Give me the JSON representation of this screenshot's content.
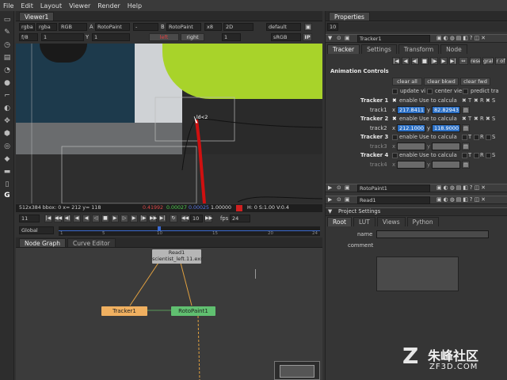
{
  "menu": [
    "File",
    "Edit",
    "Layout",
    "Viewer",
    "Render",
    "Help"
  ],
  "viewer": {
    "tab": "Viewer1",
    "channels": "rgba",
    "layer": "rgba",
    "display": "RGB",
    "a_node": "A",
    "a_input": "RotoPaint",
    "wipe": "-",
    "b_node": "B",
    "b_input": "RotoPaint",
    "zoom": "x8",
    "view_mode": "2D",
    "lut": "default",
    "fstop": "f/8",
    "gain": "1",
    "y_label": "Y",
    "gamma": "1",
    "left_label": "left",
    "right_label": "right",
    "proxy": "1",
    "colorspace": "sRGB",
    "ip_label": "IP",
    "overlay_label": "ld<2",
    "status_text": "512x384 bbox: 0  x= 212 y= 118",
    "status_r": "0.41992",
    "status_g": "0.00027",
    "status_b": "0.00025",
    "status_a": "1.00000",
    "status_hsv": "H: 0 S:1.00 V:0.4"
  },
  "timeline": {
    "frame": "11",
    "fps_label": "fps",
    "fps": "24",
    "increment": "10",
    "scope": "Global",
    "ticks": [
      "1",
      "5",
      "10",
      "15",
      "20",
      "24"
    ]
  },
  "nodegraph": {
    "tabs": [
      "Node Graph",
      "Curve Editor"
    ],
    "read_node_title": "Read1",
    "read_node_file": "scientist_left.11.exr",
    "tracker_node": "Tracker1",
    "roto_node": "RotoPaint1"
  },
  "properties": {
    "tab": "Properties",
    "max_panels": "10",
    "tracker_title": "Tracker1",
    "tracker_tabs": [
      "Tracker",
      "Settings",
      "Transform",
      "Node"
    ],
    "reset_label": "rese",
    "grab_label": "grab",
    "of_label": "r of",
    "animation_controls": "Animation Controls",
    "clear_all": "clear all",
    "clear_bkwd": "clear bkwd",
    "clear_fwd": "clear fwd",
    "update_label": "update vi",
    "center_label": "center vie",
    "predict_label": "predict tra",
    "trackers": [
      {
        "name": "Tracker 1",
        "enable": "enable",
        "use": "Use to calcula",
        "track_label": "track1",
        "x": "217.8411",
        "y": "82.82943",
        "active": true
      },
      {
        "name": "Tracker 2",
        "enable": "enable",
        "use": "Use to calcula",
        "track_label": "track2",
        "x": "212.1000",
        "y": "118.9000",
        "active": true
      },
      {
        "name": "Tracker 3",
        "enable": "enable",
        "use": "Use to calcula",
        "track_label": "track3",
        "x": "",
        "y": "",
        "active": false
      },
      {
        "name": "Tracker 4",
        "enable": "enable",
        "use": "Use to calcula",
        "track_label": "track4",
        "x": "",
        "y": "",
        "active": false
      }
    ],
    "t_label": "T",
    "r_label": "R",
    "s_label": "S",
    "x_label": "x",
    "y_label": "y",
    "rotopaint_title": "RotoPaint1",
    "read_title": "Read1",
    "project_settings": "Project Settings",
    "project_tabs": [
      "Root",
      "LUT",
      "Views",
      "Python"
    ],
    "name_label": "name",
    "comment_label": "comment"
  },
  "watermark": {
    "line1": "朱峰社区",
    "line2": "ZF3D.COM"
  }
}
